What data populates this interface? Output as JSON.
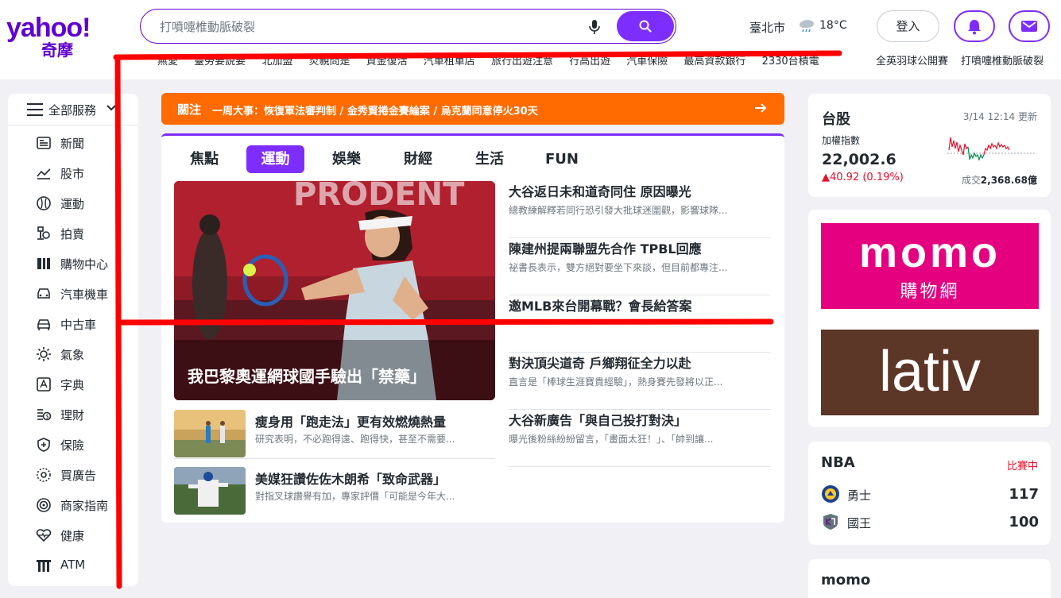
{
  "header": {
    "logo_main": "yahoo!",
    "logo_sub": "奇摩",
    "search_placeholder": "打噴嚏椎動脈破裂",
    "city": "臺北市",
    "temperature": "18°C",
    "login_label": "登入",
    "trending": [
      "無愛",
      "臺勞要說要",
      "北加盟",
      "炎親問是",
      "資金復活",
      "汽車租車店",
      "旅行出遊注意",
      "行高出遊",
      "汽車保險",
      "最高資款銀行",
      "2330台積電"
    ],
    "trending_right": [
      "全英羽球公開賽",
      "打噴嚏椎動脈破裂"
    ]
  },
  "sidebar": {
    "header_label": "全部服務",
    "items": [
      {
        "label": "新聞",
        "icon": "newspaper-icon"
      },
      {
        "label": "股市",
        "icon": "stock-chart-icon"
      },
      {
        "label": "運動",
        "icon": "sports-ball-icon"
      },
      {
        "label": "拍賣",
        "icon": "auction-icon"
      },
      {
        "label": "購物中心",
        "icon": "shopping-icon"
      },
      {
        "label": "汽車機車",
        "icon": "car-motor-icon"
      },
      {
        "label": "中古車",
        "icon": "used-car-icon"
      },
      {
        "label": "氣象",
        "icon": "sun-icon"
      },
      {
        "label": "字典",
        "icon": "dictionary-icon"
      },
      {
        "label": "理財",
        "icon": "finance-icon"
      },
      {
        "label": "保險",
        "icon": "shield-icon"
      },
      {
        "label": "買廣告",
        "icon": "ad-icon"
      },
      {
        "label": "商家指南",
        "icon": "target-icon"
      },
      {
        "label": "健康",
        "icon": "heart-pulse-icon"
      },
      {
        "label": "ATM",
        "icon": "atm-icon"
      }
    ]
  },
  "banner": {
    "tag": "關注",
    "text": "一周大事：恢復軍法審判制 / 金秀賢捲金賽綸案 / 烏克蘭同意停火30天"
  },
  "news": {
    "tabs": [
      "焦點",
      "運動",
      "娛樂",
      "財經",
      "生活",
      "FUN"
    ],
    "active_tab": "運動",
    "hero_title": "我巴黎奧運網球國手驗出「禁藥」",
    "stories": [
      {
        "title": "大谷返日未和道奇同住 原因曝光",
        "summary": "總教練解釋若同行恐引發大批球迷圍觀，影響球隊..."
      },
      {
        "title": "陳建州提兩聯盟先合作 TPBL回應",
        "summary": "祕書長表示，雙方絕對要坐下來談，但目前都專注..."
      },
      {
        "title": "邀MLB來台開幕戰？會長給答案",
        "summary": ""
      },
      {
        "title": "對決頂尖道奇 戶鄉翔征全力以赴",
        "summary": "直言是「棒球生涯寶貴經驗」，熱身賽先發將以正..."
      },
      {
        "title": "大谷新廣告「與自己投打對決」",
        "summary": "曝光後粉絲紛紛留言，「畫面太狂！」、「帥到讓..."
      }
    ],
    "small_stories": [
      {
        "title": "瘦身用「跑走法」更有效燃燒熱量",
        "summary": "研究表明，不必跑得遠、跑得快，甚至不需要..."
      },
      {
        "title": "美媒狂讚佐佐木朗希「致命武器」",
        "summary": "對指叉球讚譽有加，專家評價「可能是今年大..."
      }
    ]
  },
  "stock": {
    "title": "台股",
    "updated": "3/14 12:14 更新",
    "index_name": "加權指數",
    "value": "22,002.6",
    "change": "▲40.92 (0.19%)",
    "volume_label": "成交",
    "volume": "2,368.68億",
    "colors": {
      "up": "#eb0f29",
      "down": "#008a4b"
    }
  },
  "ads": {
    "momo_logo": "momo",
    "momo_sub": "購物網",
    "lativ_logo": "lativ"
  },
  "nba": {
    "title": "NBA",
    "status": "比賽中",
    "teams": [
      {
        "name": "勇士",
        "score": "117"
      },
      {
        "name": "國王",
        "score": "100"
      }
    ]
  },
  "momo_card": {
    "title": "momo"
  },
  "colors": {
    "brand": "#6001d2",
    "accent": "#7d2eff",
    "banner": "#ff6b00",
    "annotation": "#ff0000"
  }
}
